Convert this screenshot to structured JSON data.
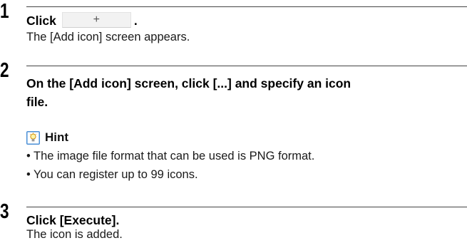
{
  "steps": [
    {
      "number": "1",
      "heading_prefix": "Click",
      "button_label": "+",
      "heading_suffix": ".",
      "body": "The [Add icon] screen appears."
    },
    {
      "number": "2",
      "heading_line1": "On the [Add icon] screen, click [...] and specify an icon",
      "heading_line2": "file.",
      "hint": {
        "label": "Hint",
        "icon": "lightbulb-icon",
        "bullet_glyph": "•",
        "bullets": [
          "The image file format that can be used is PNG format.",
          "You can register up to 99 icons."
        ]
      }
    },
    {
      "number": "3",
      "heading": "Click [Execute].",
      "body": "The icon is added."
    }
  ]
}
